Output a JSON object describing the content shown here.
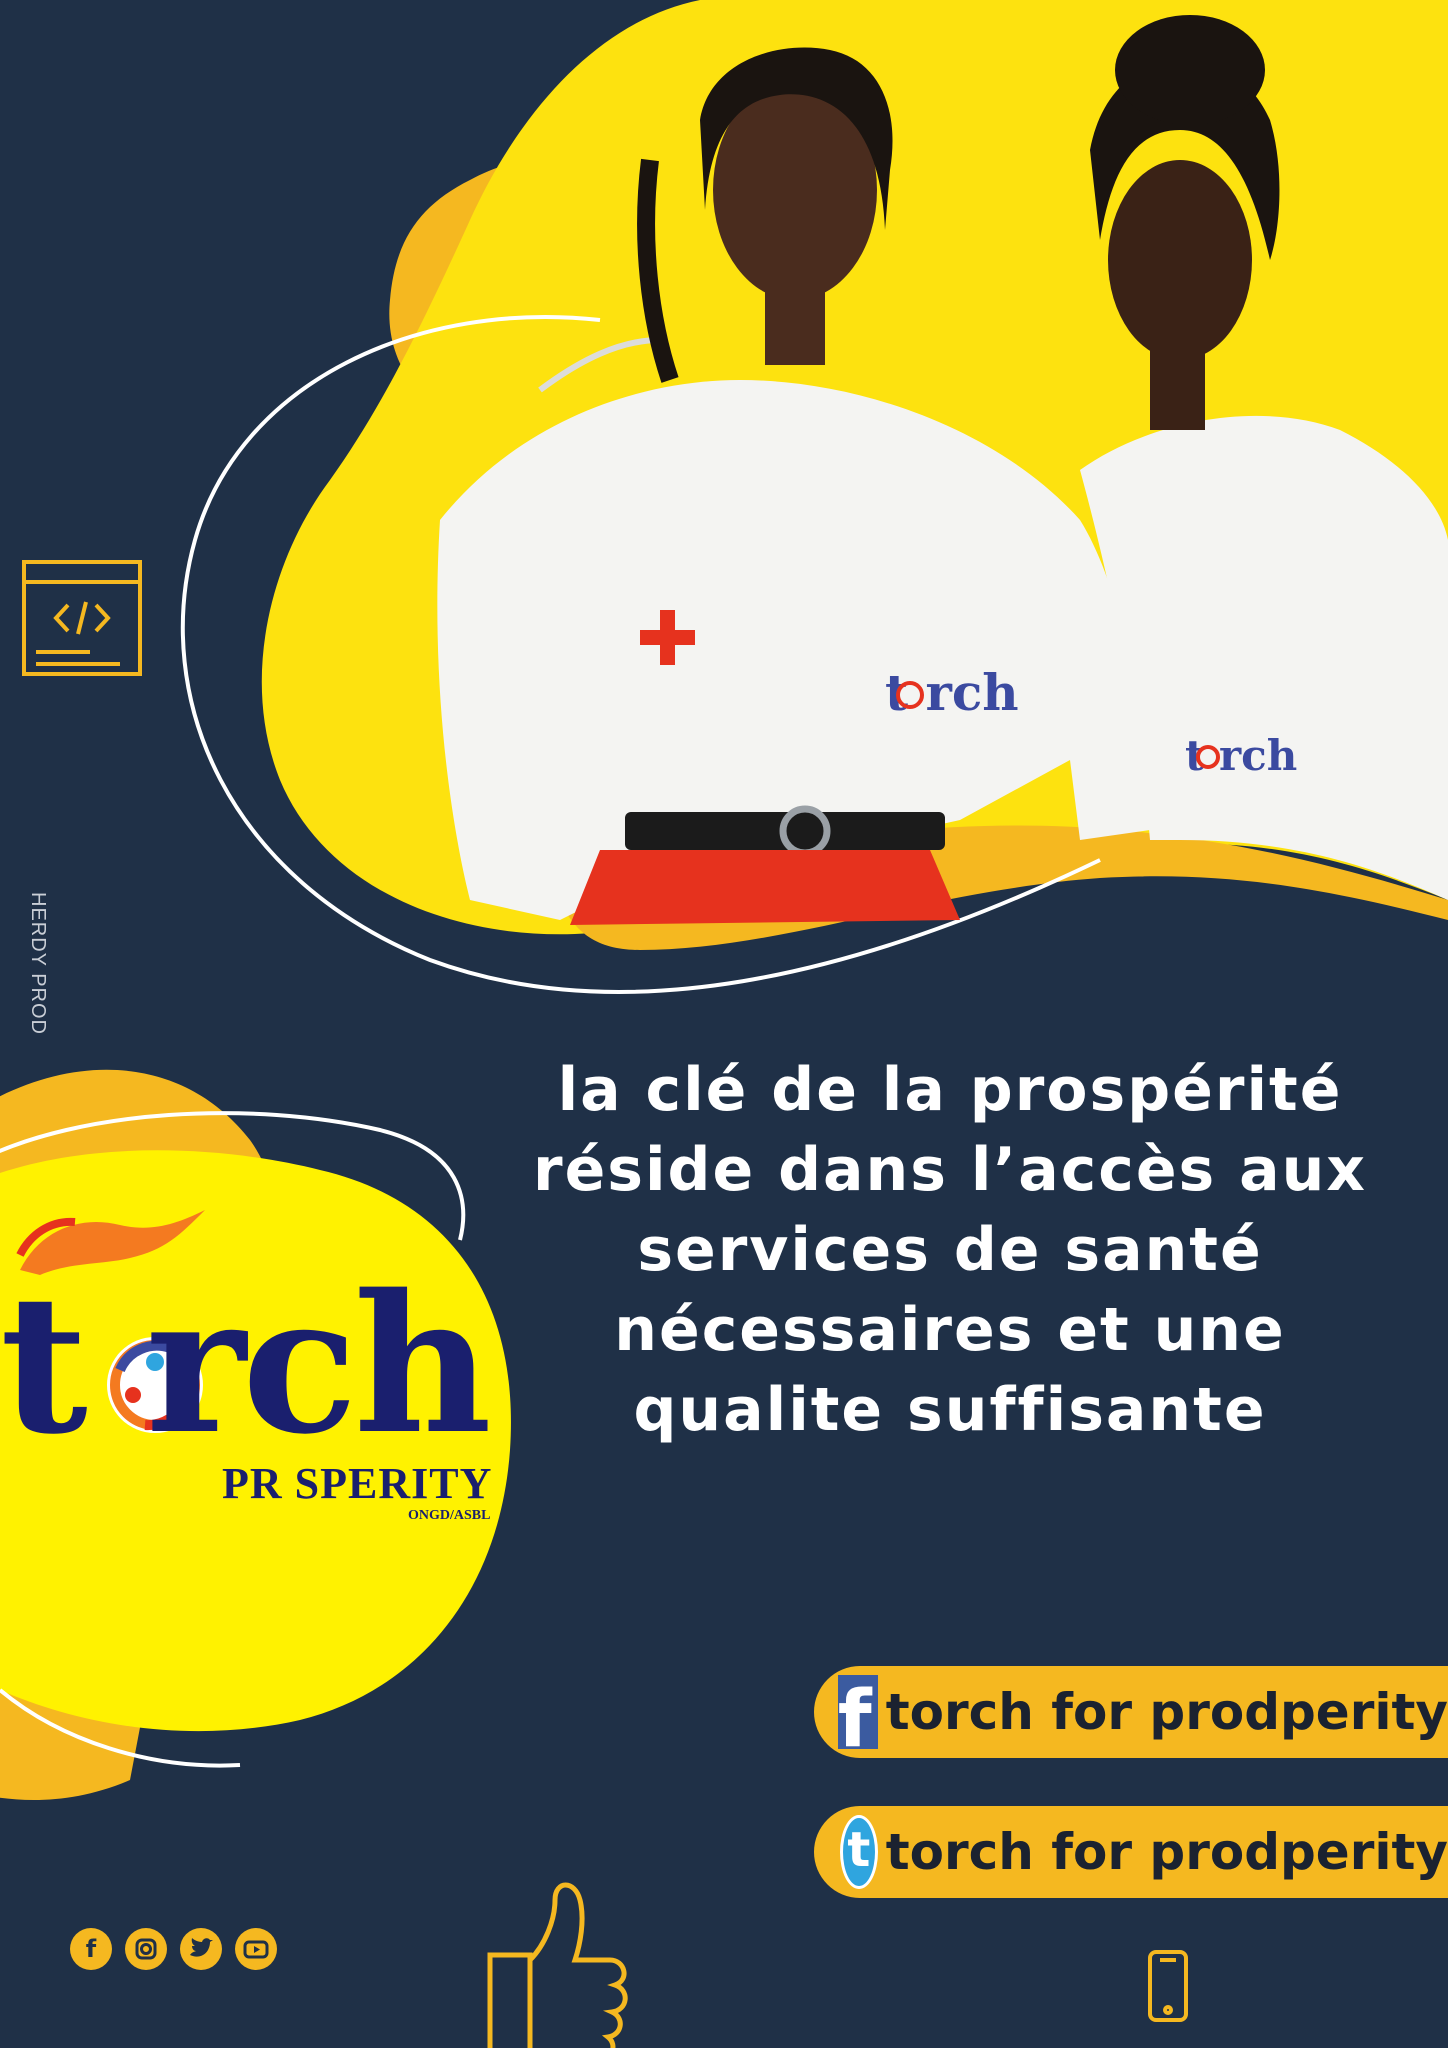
{
  "poster": {
    "credit": "HERDY PROD",
    "headline": [
      "la clé de la prospérité",
      "réside dans l’accès aux",
      "services de santé",
      "nécessaires et une",
      "qualite suffisante"
    ]
  },
  "logo": {
    "torch_word": "t rch",
    "prosperity": "PR SPERITY",
    "ongd": "ONGD/ASBL"
  },
  "shirt_logos": [
    "torch",
    "torch"
  ],
  "social": {
    "facebook_label": "torch for prodperity",
    "twitter_label": "torch for prodperity",
    "facebook_glyph": "f",
    "twitter_glyph": "t"
  },
  "footer_icons": [
    "facebook-icon",
    "instagram-icon",
    "twitter-icon",
    "youtube-icon"
  ],
  "colors": {
    "navy": "#1f3047",
    "yellow": "#fff200",
    "orange": "#f5b820",
    "logo_blue": "#1a1f6e",
    "facebook": "#3b5ba0",
    "twitter": "#2fa5df"
  }
}
